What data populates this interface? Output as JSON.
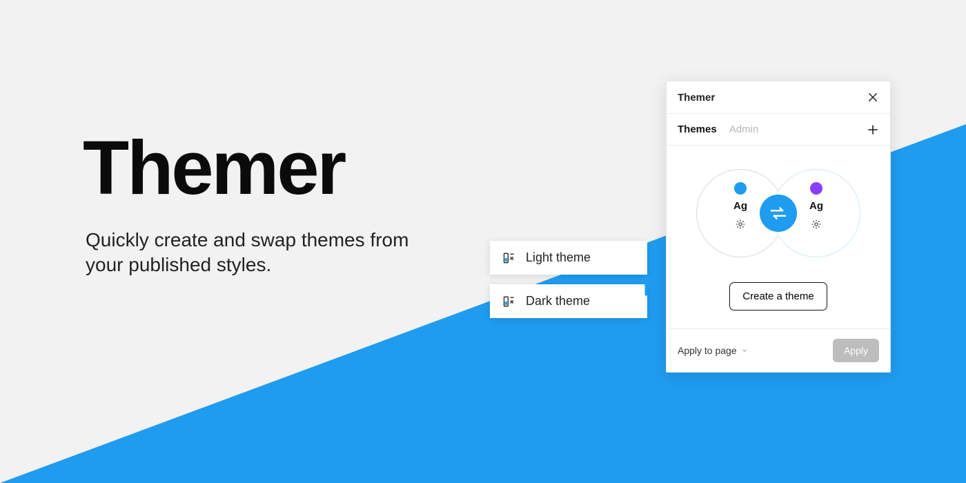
{
  "hero": {
    "title": "Themer",
    "subtitle": "Quickly create and swap themes from your published styles."
  },
  "theme_cards": {
    "light": "Light theme",
    "dark": "Dark theme"
  },
  "panel": {
    "title": "Themer",
    "tabs": {
      "themes": "Themes",
      "admin": "Admin"
    },
    "sample_text": "Ag",
    "create_button": "Create a theme",
    "footer": {
      "scope_label": "Apply to page",
      "apply_label": "Apply"
    }
  },
  "colors": {
    "accent": "#1f9cf0",
    "purple": "#8a3ffc",
    "bg": "#f2f2f2"
  }
}
